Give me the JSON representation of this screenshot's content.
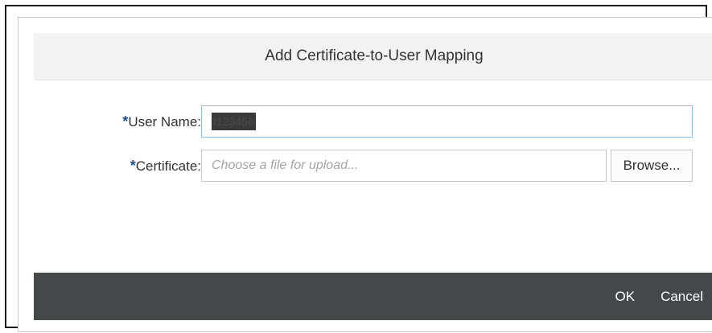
{
  "dialog": {
    "title": "Add Certificate-to-User Mapping"
  },
  "form": {
    "required_mark": "*",
    "user_name": {
      "label": "User Name:",
      "value": "I123456"
    },
    "certificate": {
      "label": "Certificate:",
      "placeholder": "Choose a file for upload...",
      "browse_label": "Browse..."
    }
  },
  "footer": {
    "ok_label": "OK",
    "cancel_label": "Cancel"
  },
  "colors": {
    "required_mark": "#1a4e8c",
    "footer_background": "#43484b",
    "input_focus_border": "#8fbfe3"
  }
}
